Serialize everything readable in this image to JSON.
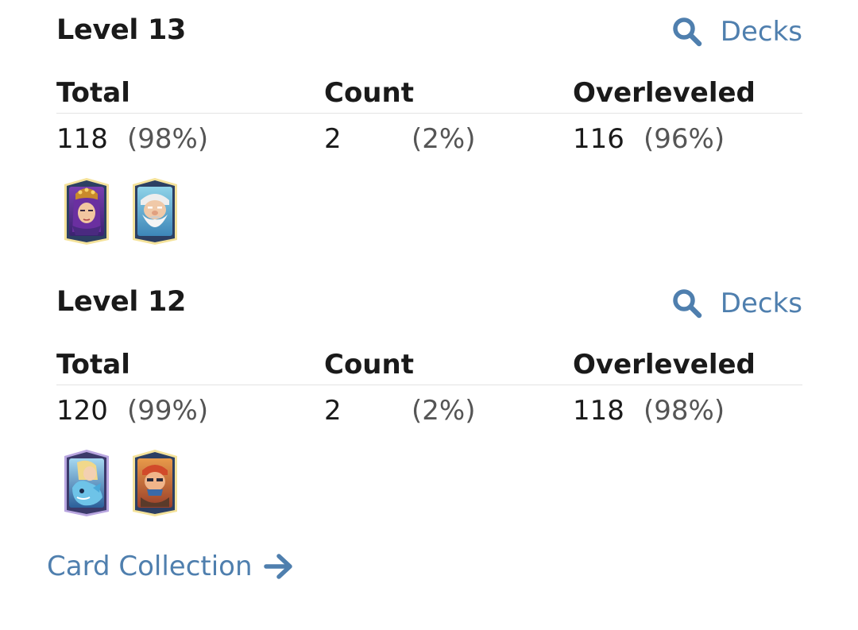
{
  "levels": [
    {
      "title": "Level 13",
      "decks_label": "Decks",
      "headers": {
        "total": "Total",
        "count": "Count",
        "overleveled": "Overleveled"
      },
      "total": {
        "value": "118",
        "percent": "(98%)"
      },
      "count": {
        "value": "2",
        "percent": "(2%)"
      },
      "overleveled": {
        "value": "116",
        "percent": "(96%)"
      },
      "cards": [
        {
          "name": "archer-queen-card-icon"
        },
        {
          "name": "royal-ghost-card-icon"
        }
      ]
    },
    {
      "title": "Level 12",
      "decks_label": "Decks",
      "headers": {
        "total": "Total",
        "count": "Count",
        "overleveled": "Overleveled"
      },
      "total": {
        "value": "120",
        "percent": "(99%)"
      },
      "count": {
        "value": "2",
        "percent": "(2%)"
      },
      "overleveled": {
        "value": "118",
        "percent": "(98%)"
      },
      "cards": [
        {
          "name": "phoenix-card-icon"
        },
        {
          "name": "goblin-card-icon"
        }
      ]
    }
  ],
  "footer": {
    "collection_label": "Card Collection"
  },
  "colors": {
    "link": "#4f7fae",
    "text": "#1a1a1a",
    "muted": "#555555",
    "divider": "#e3e3e3"
  },
  "icons": {
    "decks": "search-icon",
    "collection": "arrow-right-icon"
  }
}
